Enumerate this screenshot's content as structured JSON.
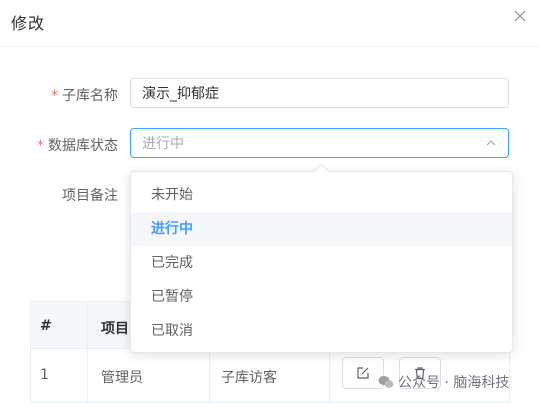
{
  "dialog": {
    "title": "修改"
  },
  "form": {
    "sublib_label": "子库名称",
    "sublib_value": "演示_抑郁症",
    "status_label": "数据库状态",
    "status_placeholder": "进行中",
    "remark_label": "项目备注"
  },
  "dropdown": {
    "options": [
      "未开始",
      "进行中",
      "已完成",
      "已暂停",
      "已取消"
    ],
    "selected_index": 1
  },
  "table": {
    "headers": [
      "#",
      "项目"
    ],
    "rows": [
      {
        "index": "1",
        "name": "管理员",
        "role": "子库访客"
      }
    ]
  },
  "watermark": {
    "text": "公众号 · 脑海科技"
  },
  "colors": {
    "accent": "#409eff",
    "required": "#f56c6c"
  },
  "icons": [
    "close-icon",
    "chevron-up-icon",
    "edit-icon",
    "trash-icon",
    "wechat-icon"
  ]
}
